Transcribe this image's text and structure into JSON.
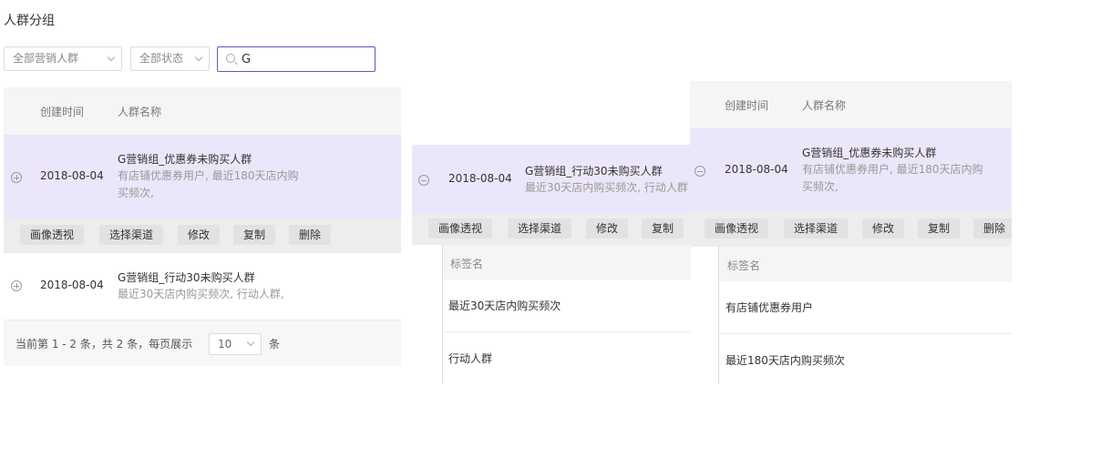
{
  "page": {
    "title": "人群分组"
  },
  "filters": {
    "group_select": "全部营销人群",
    "status_select": "全部状态",
    "search_value": "G"
  },
  "table": {
    "col_date": "创建时间",
    "col_name": "人群名称",
    "rows": [
      {
        "date": "2018-08-04",
        "name": "G营销组_优惠券未购买人群",
        "desc_line1": "有店铺优惠券用户, 最近180天店内购",
        "desc_line2": "买频次,"
      },
      {
        "date": "2018-08-04",
        "name": "G营销组_行动30未购买人群",
        "desc": "最近30天店内购买频次, 行动人群,"
      }
    ],
    "actions": [
      "画像透视",
      "选择渠道",
      "修改",
      "复制",
      "删除"
    ]
  },
  "pagination": {
    "prefix": "当前第 1 - 2 条，共 2 条，每页展示",
    "page_size": "10",
    "suffix": "条"
  },
  "panel_b": {
    "date": "2018-08-04",
    "name": "G营销组_行动30未购买人群",
    "desc": "最近30天店内购买频次, 行动人群",
    "actions": [
      "画像透视",
      "选择渠道",
      "修改",
      "复制"
    ],
    "tag_header": "标签名",
    "tags": [
      "最近30天店内购买频次",
      "行动人群"
    ]
  },
  "panel_c": {
    "col_date": "创建时间",
    "col_name": "人群名称",
    "date": "2018-08-04",
    "name": "G营销组_优惠券未购买人群",
    "desc_line1": "有店铺优惠券用户, 最近180天店内购",
    "desc_line2": "买频次,",
    "actions": [
      "画像透视",
      "选择渠道",
      "修改",
      "复制",
      "删除"
    ],
    "tag_header": "标签名",
    "tags": [
      "有店铺优惠券用户",
      "最近180天店内购买频次"
    ]
  }
}
